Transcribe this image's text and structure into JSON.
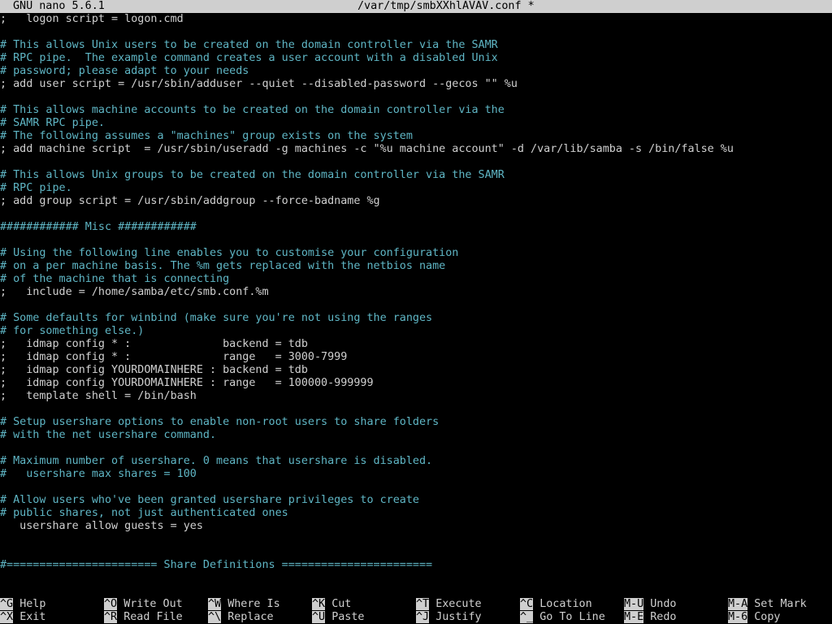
{
  "title_bar": {
    "app_version": "GNU nano 5.6.1",
    "filename": "/var/tmp/smbXXhlAVAV.conf *"
  },
  "lines": [
    {
      "text": ";   logon script = logon.cmd",
      "type": "code"
    },
    {
      "text": "",
      "type": "code"
    },
    {
      "text": "# This allows Unix users to be created on the domain controller via the SAMR",
      "type": "comment"
    },
    {
      "text": "# RPC pipe.  The example command creates a user account with a disabled Unix",
      "type": "comment"
    },
    {
      "text": "# password; please adapt to your needs",
      "type": "comment"
    },
    {
      "text": "; add user script = /usr/sbin/adduser --quiet --disabled-password --gecos \"\" %u",
      "type": "code"
    },
    {
      "text": "",
      "type": "code"
    },
    {
      "text": "# This allows machine accounts to be created on the domain controller via the",
      "type": "comment"
    },
    {
      "text": "# SAMR RPC pipe.",
      "type": "comment"
    },
    {
      "text": "# The following assumes a \"machines\" group exists on the system",
      "type": "comment"
    },
    {
      "text": "; add machine script  = /usr/sbin/useradd -g machines -c \"%u machine account\" -d /var/lib/samba -s /bin/false %u",
      "type": "code"
    },
    {
      "text": "",
      "type": "code"
    },
    {
      "text": "# This allows Unix groups to be created on the domain controller via the SAMR",
      "type": "comment"
    },
    {
      "text": "# RPC pipe.",
      "type": "comment"
    },
    {
      "text": "; add group script = /usr/sbin/addgroup --force-badname %g",
      "type": "code"
    },
    {
      "text": "",
      "type": "code"
    },
    {
      "text": "############ Misc ############",
      "type": "header"
    },
    {
      "text": "",
      "type": "code"
    },
    {
      "text": "# Using the following line enables you to customise your configuration",
      "type": "comment"
    },
    {
      "text": "# on a per machine basis. The %m gets replaced with the netbios name",
      "type": "comment"
    },
    {
      "text": "# of the machine that is connecting",
      "type": "comment"
    },
    {
      "text": ";   include = /home/samba/etc/smb.conf.%m",
      "type": "code"
    },
    {
      "text": "",
      "type": "code"
    },
    {
      "text": "# Some defaults for winbind (make sure you're not using the ranges",
      "type": "comment"
    },
    {
      "text": "# for something else.)",
      "type": "comment"
    },
    {
      "text": ";   idmap config * :              backend = tdb",
      "type": "code"
    },
    {
      "text": ";   idmap config * :              range   = 3000-7999",
      "type": "code"
    },
    {
      "text": ";   idmap config YOURDOMAINHERE : backend = tdb",
      "type": "code"
    },
    {
      "text": ";   idmap config YOURDOMAINHERE : range   = 100000-999999",
      "type": "code"
    },
    {
      "text": ";   template shell = /bin/bash",
      "type": "code"
    },
    {
      "text": "",
      "type": "code"
    },
    {
      "text": "# Setup usershare options to enable non-root users to share folders",
      "type": "comment"
    },
    {
      "text": "# with the net usershare command.",
      "type": "comment"
    },
    {
      "text": "",
      "type": "code"
    },
    {
      "text": "# Maximum number of usershare. 0 means that usershare is disabled.",
      "type": "comment"
    },
    {
      "text": "#   usershare max shares = 100",
      "type": "comment"
    },
    {
      "text": "",
      "type": "code"
    },
    {
      "text": "# Allow users who've been granted usershare privileges to create",
      "type": "comment"
    },
    {
      "text": "# public shares, not just authenticated ones",
      "type": "comment"
    },
    {
      "text": "   usershare allow guests = yes",
      "type": "code"
    },
    {
      "text": "",
      "type": "code"
    },
    {
      "text": "",
      "type": "code"
    },
    {
      "text": "#======================= Share Definitions =======================",
      "type": "header"
    }
  ],
  "shortcuts": [
    {
      "key": "^G",
      "label": "Help"
    },
    {
      "key": "^X",
      "label": "Exit"
    },
    {
      "key": "^O",
      "label": "Write Out"
    },
    {
      "key": "^R",
      "label": "Read File"
    },
    {
      "key": "^W",
      "label": "Where Is"
    },
    {
      "key": "^\\",
      "label": "Replace"
    },
    {
      "key": "^K",
      "label": "Cut"
    },
    {
      "key": "^U",
      "label": "Paste"
    },
    {
      "key": "^T",
      "label": "Execute"
    },
    {
      "key": "^J",
      "label": "Justify"
    },
    {
      "key": "^C",
      "label": "Location"
    },
    {
      "key": "^_",
      "label": "Go To Line"
    },
    {
      "key": "M-U",
      "label": "Undo"
    },
    {
      "key": "M-E",
      "label": "Redo"
    },
    {
      "key": "M-A",
      "label": "Set Mark"
    },
    {
      "key": "M-6",
      "label": "Copy"
    }
  ],
  "colors": {
    "background": "#000000",
    "text": "#d0d0d0",
    "comment": "#5fb6c5",
    "bar": "#cfcfcf"
  }
}
